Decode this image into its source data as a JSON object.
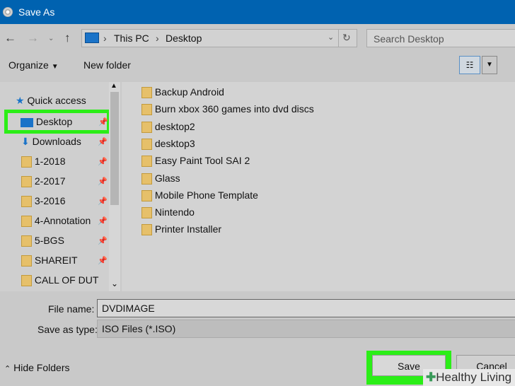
{
  "window": {
    "title": "Save As"
  },
  "address": {
    "segments": [
      "This PC",
      "Desktop"
    ]
  },
  "search": {
    "placeholder": "Search Desktop"
  },
  "toolbar": {
    "organize": "Organize",
    "new_folder": "New folder"
  },
  "sidebar": {
    "quick_access": "Quick access",
    "items": [
      {
        "label": "Desktop",
        "icon": "desktop-icon"
      },
      {
        "label": "Downloads",
        "icon": "download-icon"
      },
      {
        "label": "1-2018",
        "icon": "folder-icon"
      },
      {
        "label": "2-2017",
        "icon": "folder-icon"
      },
      {
        "label": "3-2016",
        "icon": "folder-icon"
      },
      {
        "label": "4-Annotation",
        "icon": "folder-icon"
      },
      {
        "label": "5-BGS",
        "icon": "folder-icon"
      },
      {
        "label": "SHAREIT",
        "icon": "folder-icon"
      },
      {
        "label": "CALL OF DUT",
        "icon": "folder-icon"
      }
    ]
  },
  "files": [
    "Backup Android",
    "Burn xbox 360 games into dvd discs",
    "desktop2",
    "desktop3",
    "Easy Paint Tool SAI 2",
    "Glass",
    "Mobile Phone Template",
    "Nintendo",
    "Printer Installer"
  ],
  "form": {
    "file_name_label": "File name:",
    "file_name": "DVDIMAGE",
    "type_label": "Save as type:",
    "type": "ISO Files (*.ISO)"
  },
  "footer": {
    "hide_folders": "Hide Folders",
    "save": "Save",
    "cancel": "Cancel"
  },
  "watermark": "Healthy Living",
  "colors": {
    "titlebar": "#0062b0",
    "highlight": "#2bee17"
  }
}
